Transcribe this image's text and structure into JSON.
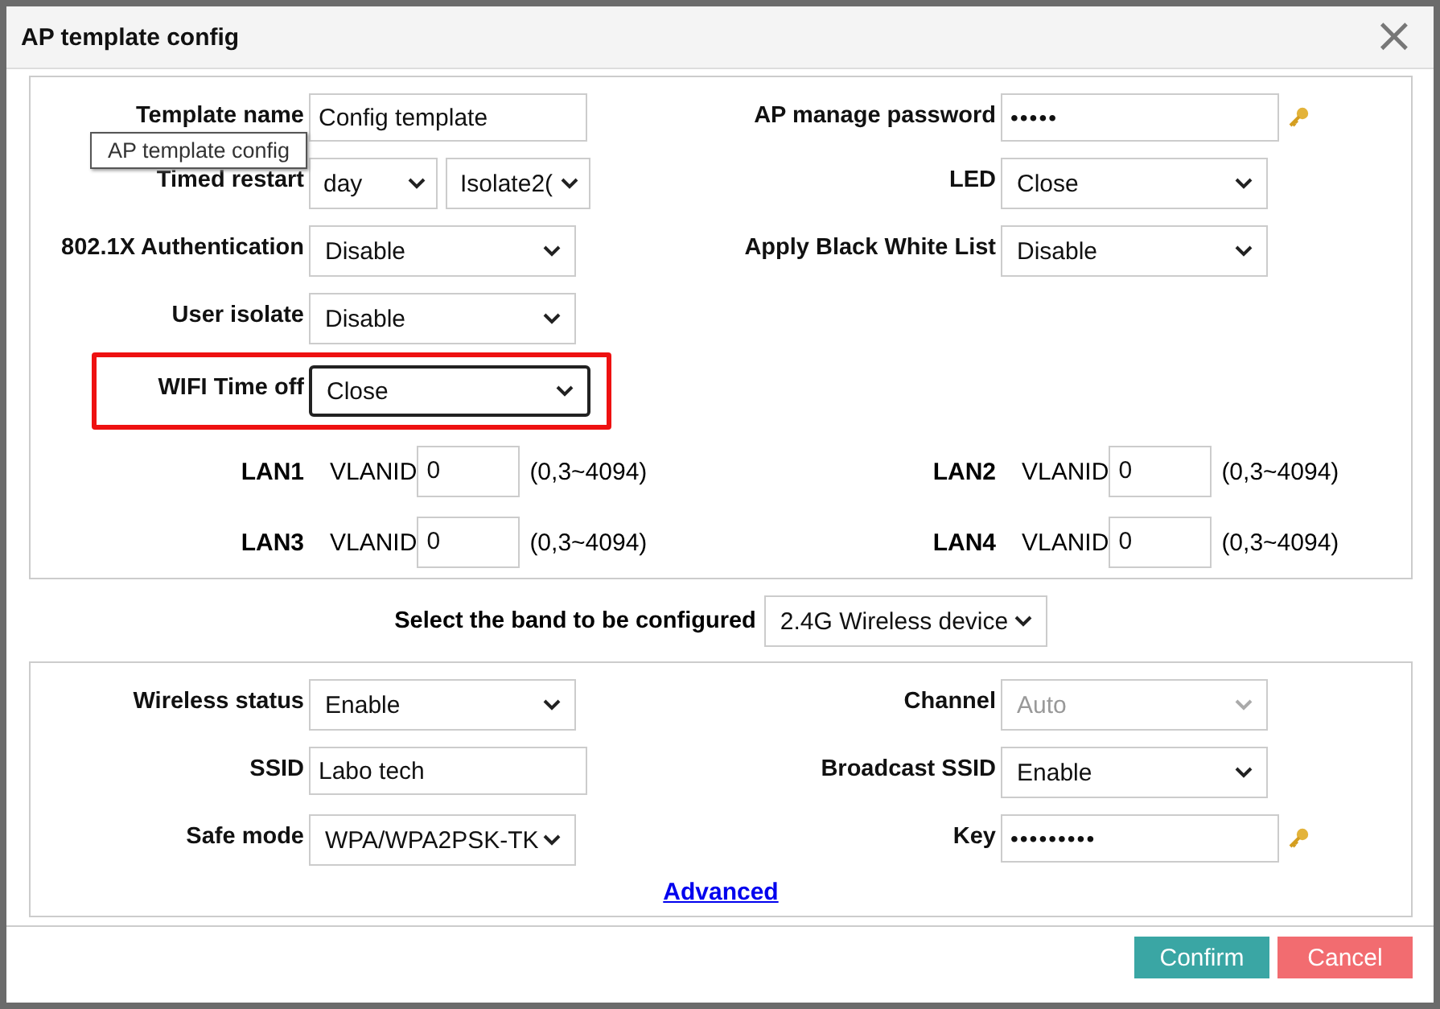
{
  "window": {
    "title": "AP template config",
    "close": "×"
  },
  "general": {
    "rows": [
      {
        "left": {
          "label": "Template name",
          "kind": "text",
          "value": "Config template"
        },
        "right": {
          "label": "AP manage password",
          "kind": "password",
          "value": "•••••"
        }
      },
      {
        "left": {
          "label": "Timed restart",
          "kind": "select-pair",
          "values": [
            "day",
            "Isolate2("
          ]
        },
        "right": {
          "label": "LED",
          "kind": "select",
          "value": "Close"
        }
      },
      {
        "left": {
          "label": "802.1X Authentication",
          "kind": "select",
          "value": "Disable"
        },
        "right": {
          "label": "Apply Black White List",
          "kind": "select",
          "value": "Disable"
        }
      },
      {
        "left": {
          "label": "User isolate",
          "kind": "select",
          "value": "Disable"
        }
      },
      {
        "left": {
          "label": "WIFI Time off",
          "kind": "select",
          "value": "Close",
          "highlighted": true
        }
      }
    ],
    "lans": [
      {
        "label": "LAN1",
        "vlan_label": "VLANID",
        "value": "0",
        "range": "(0,3~4094)"
      },
      {
        "label": "LAN2",
        "vlan_label": "VLANID",
        "value": "0",
        "range": "(0,3~4094)"
      },
      {
        "label": "LAN3",
        "vlan_label": "VLANID",
        "value": "0",
        "range": "(0,3~4094)"
      },
      {
        "label": "LAN4",
        "vlan_label": "VLANID",
        "value": "0",
        "range": "(0,3~4094)"
      }
    ]
  },
  "tooltip": "AP template config",
  "band": {
    "label": "Select the band to be configured",
    "value": "2.4G Wireless device"
  },
  "wireless": {
    "rows": [
      {
        "left": {
          "label": "Wireless status",
          "kind": "select",
          "value": "Enable"
        },
        "right": {
          "label": "Channel",
          "kind": "select",
          "value": "Auto",
          "disabled": true
        }
      },
      {
        "left": {
          "label": "SSID",
          "kind": "text",
          "value": "Labo tech"
        },
        "right": {
          "label": "Broadcast SSID",
          "kind": "select",
          "value": "Enable"
        }
      },
      {
        "left": {
          "label": "Safe mode",
          "kind": "select",
          "value": "WPA/WPA2PSK-TK"
        },
        "right": {
          "label": "Key",
          "kind": "password",
          "value": "•••••••••"
        }
      }
    ],
    "advanced": "Advanced"
  },
  "buttons": [
    {
      "label": "Confirm",
      "kind": "primary"
    },
    {
      "label": "Cancel",
      "kind": "danger"
    }
  ]
}
